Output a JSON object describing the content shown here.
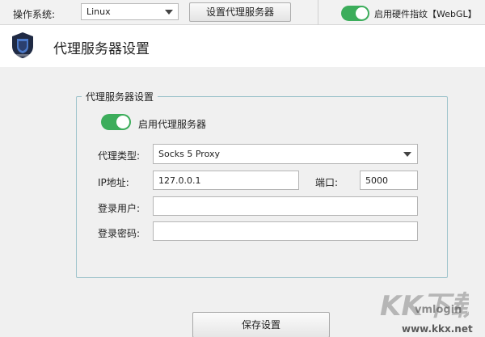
{
  "topbar": {
    "os_label": "操作系统:",
    "os_value": "Linux",
    "proxy_button": "设置代理服务器",
    "hardware_toggle_label": "启用硬件指纹【WebGL】",
    "hardware_toggle_on": true
  },
  "dialog": {
    "title": "代理服务器设置",
    "group_title": "代理服务器设置",
    "enable_proxy_label": "启用代理服务器",
    "enable_proxy_on": true,
    "proxy_type_label": "代理类型:",
    "proxy_type_value": "Socks 5 Proxy",
    "ip_label": "IP地址:",
    "ip_value": "127.0.0.1",
    "port_label": "端口:",
    "port_value": "5000",
    "username_label": "登录用户:",
    "username_value": "",
    "password_label": "登录密码:",
    "password_value": "",
    "save_button": "保存设置"
  },
  "watermark": {
    "logo_text": "KK下载",
    "brand": "vmlogin",
    "url": "www.kkx.net"
  },
  "colors": {
    "toggle_on": "#3cad5b",
    "group_border": "#9fc4cc",
    "logo_dark": "#1f2a44",
    "logo_accent": "#4a78c8"
  },
  "icons": {
    "app_logo": "vmlogin-shield-logo",
    "dropdown": "chevron-down-icon"
  }
}
